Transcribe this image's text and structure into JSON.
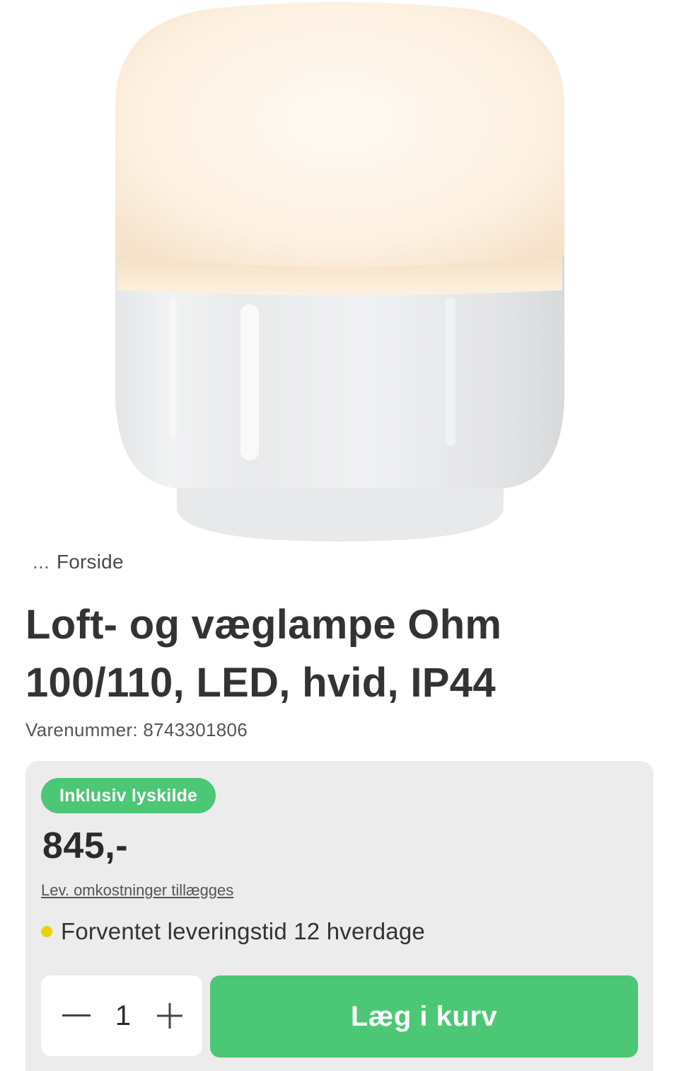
{
  "product": {
    "image_alt": "lamp-photo",
    "breadcrumb": {
      "ellipsis": "...",
      "label": "Forside"
    },
    "title_line1": "Loft- og væglampe Ohm",
    "title_line2": "100/110, LED, hvid, IP44",
    "sku_label": "Varenummer:",
    "sku_value": "8743301806"
  },
  "buy_box": {
    "badge": "Inklusiv lyskilde",
    "price": "845,-",
    "shipping_link": "Lev. omkostninger tillægges",
    "delivery_text": "Forventet leveringstid 12 hverdage",
    "delivery_status_color": "#f2d000",
    "quantity": "1",
    "add_to_cart_label": "Læg i kurv",
    "accent_color": "#4cc775"
  }
}
